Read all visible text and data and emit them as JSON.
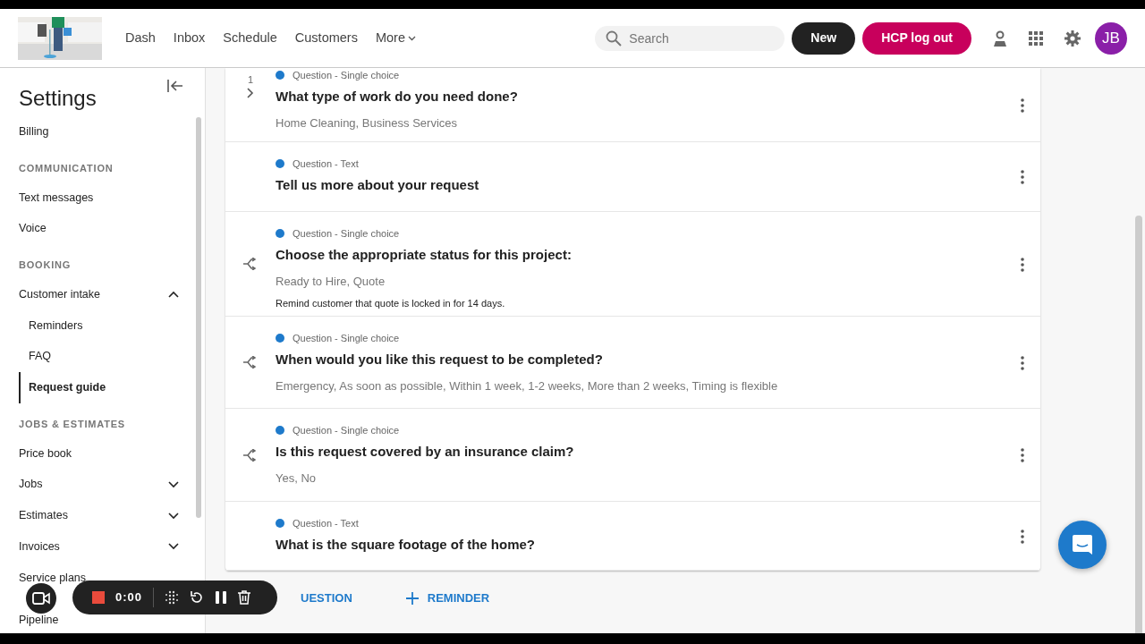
{
  "nav": {
    "tabs": [
      {
        "label": "Dash"
      },
      {
        "label": "Inbox"
      },
      {
        "label": "Schedule"
      },
      {
        "label": "Customers"
      },
      {
        "label": "More",
        "dropdown": true
      }
    ],
    "search": {
      "placeholder": "Search"
    },
    "new_button": "New",
    "logout_button": "HCP log out",
    "avatar": "JB"
  },
  "sidebar": {
    "title": "Settings",
    "items": [
      {
        "kind": "item",
        "label": "Billing"
      },
      {
        "kind": "section",
        "label": "COMMUNICATION"
      },
      {
        "kind": "item",
        "label": "Text messages"
      },
      {
        "kind": "item",
        "label": "Voice"
      },
      {
        "kind": "section",
        "label": "BOOKING"
      },
      {
        "kind": "item",
        "label": "Customer intake",
        "expanded": true,
        "children": [
          {
            "label": "Reminders",
            "selected": false
          },
          {
            "label": "FAQ",
            "selected": false
          },
          {
            "label": "Request guide",
            "selected": true
          }
        ]
      },
      {
        "kind": "section",
        "label": "JOBS & ESTIMATES"
      },
      {
        "kind": "item",
        "label": "Price book"
      },
      {
        "kind": "item",
        "label": "Jobs",
        "expanded": false
      },
      {
        "kind": "item",
        "label": "Estimates",
        "expanded": false
      },
      {
        "kind": "item",
        "label": "Invoices",
        "expanded": false
      },
      {
        "kind": "item",
        "label": "Service plans"
      },
      {
        "kind": "item",
        "label": "Pipeline"
      }
    ]
  },
  "questions": [
    {
      "kind": "numbered",
      "number": "1",
      "type": "Question - Single choice",
      "title": "What type of work do you need done?",
      "options": "Home Cleaning, Business Services"
    },
    {
      "kind": "plain",
      "type": "Question - Text",
      "title": "Tell us more about your request"
    },
    {
      "kind": "branch",
      "type": "Question - Single choice",
      "title": "Choose the appropriate status for this project:",
      "options": "Ready to Hire, Quote",
      "note": "Remind customer that quote is locked in for 14 days."
    },
    {
      "kind": "branch",
      "type": "Question - Single choice",
      "title": "When would you like this request to be completed?",
      "options": "Emergency, As soon as possible, Within 1 week, 1-2 weeks, More than 2 weeks, Timing is flexible"
    },
    {
      "kind": "branch",
      "type": "Question - Single choice",
      "title": "Is this request covered by an insurance claim?",
      "options": "Yes, No"
    },
    {
      "kind": "plain",
      "type": "Question - Text",
      "title": "What is the square footage of the home?"
    }
  ],
  "actions": [
    {
      "label": "UESTION",
      "icon": false
    },
    {
      "label": "REMINDER",
      "icon": true
    }
  ],
  "recorder": {
    "time": "0:00"
  }
}
